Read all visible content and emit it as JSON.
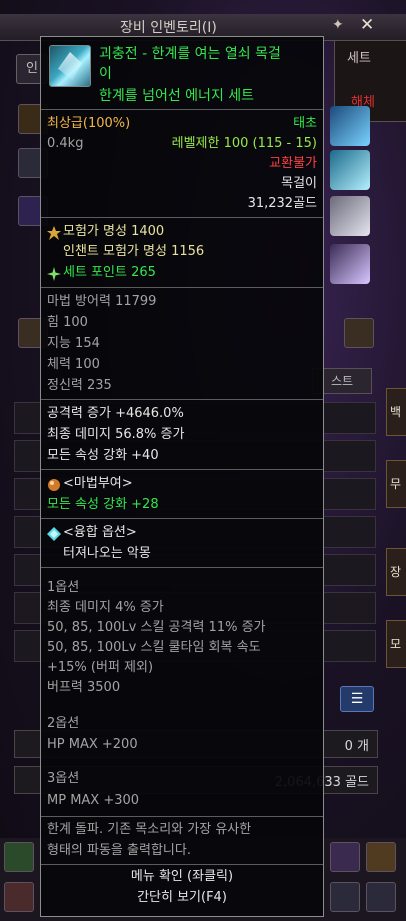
{
  "background": {
    "window_title": "장비 인벤토리(I)",
    "tab_label": "인",
    "right_panel_title": "세트",
    "right_panel_subtitle": "해체",
    "list_tab_label": "스트",
    "count_value": "0 개",
    "gold_value": "2,064,633 골드",
    "side_label_1": "백",
    "side_label_2": "무",
    "side_label_3": "장",
    "side_label_4": "모"
  },
  "tooltip": {
    "item_name_line1": "괴충전 - 한계를 여는 열쇠 목걸",
    "item_name_line2": "이",
    "set_name": "한계를 넘어선 에너지 세트",
    "grade": "최상급(100%)",
    "rarity": "태초",
    "weight": "0.4kg",
    "level_limit": "레벨제한 100 (115 - 15)",
    "trade": "교환불가",
    "type": "목걸이",
    "price": "31,232골드",
    "adventurer_fame_label": "모험가 명성 1400",
    "enchant_fame_label": "인챈트 모험가 명성 1156",
    "set_point_label": "세트 포인트 265",
    "stats": [
      "마법 방어력 11799",
      "힘 100",
      "지능 154",
      "체력 100",
      "정신력 235"
    ],
    "main_options": [
      "공격력 증가 +4646.0%",
      "최종 데미지 56.8% 증가",
      "모든 속성 강화 +40"
    ],
    "enchant_title": "<마법부여>",
    "enchant_value": "모든 속성 강화 +28",
    "fusion_title": "<융합 옵션>",
    "fusion_value": "터져나오는 악몽",
    "option1_title": "1옵션",
    "option1_lines": [
      "최종 데미지 4% 증가",
      "50, 85, 100Lv 스킬 공격력 11% 증가",
      "50, 85, 100Lv 스킬 쿨타임 회복 속도",
      "+15% (버퍼 제외)",
      "버프력 3500"
    ],
    "option2_title": "2옵션",
    "option2_value": "HP MAX +200",
    "option3_title": "3옵션",
    "option3_value": "MP MAX +300",
    "flavor_line1": "한계 돌파. 기존 목소리와 가장 유사한",
    "flavor_line2": "형태의 파동을 출력합니다.",
    "menu_confirm": "메뉴 확인 (좌클릭)",
    "simple_view": "간단히 보기(F4)"
  },
  "colors": {
    "tooltip_bg": "#06060a",
    "set_green": "#33e64d",
    "untradeable_red": "#ff4040",
    "grade_orange": "#f1b64a"
  }
}
